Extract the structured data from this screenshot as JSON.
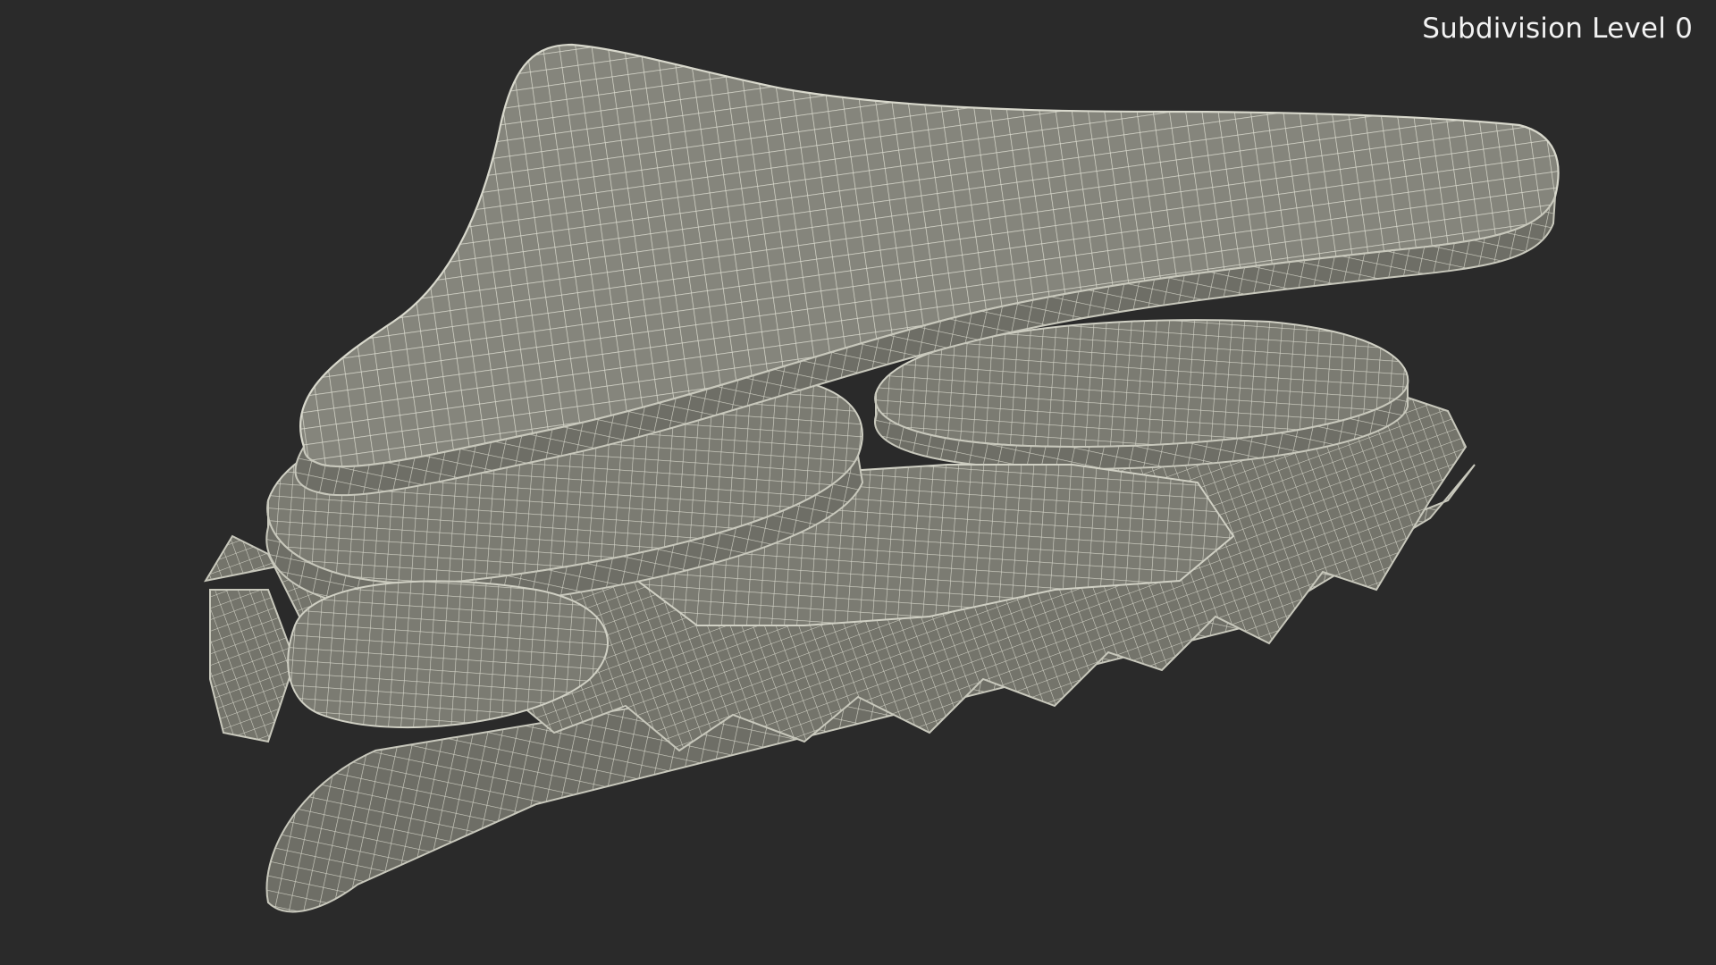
{
  "viewport": {
    "background_color": "#2a2a2a",
    "mesh_color": "#85857c",
    "wire_color": "#d4d4c8"
  },
  "overlay": {
    "label": "Subdivision Level 0"
  }
}
